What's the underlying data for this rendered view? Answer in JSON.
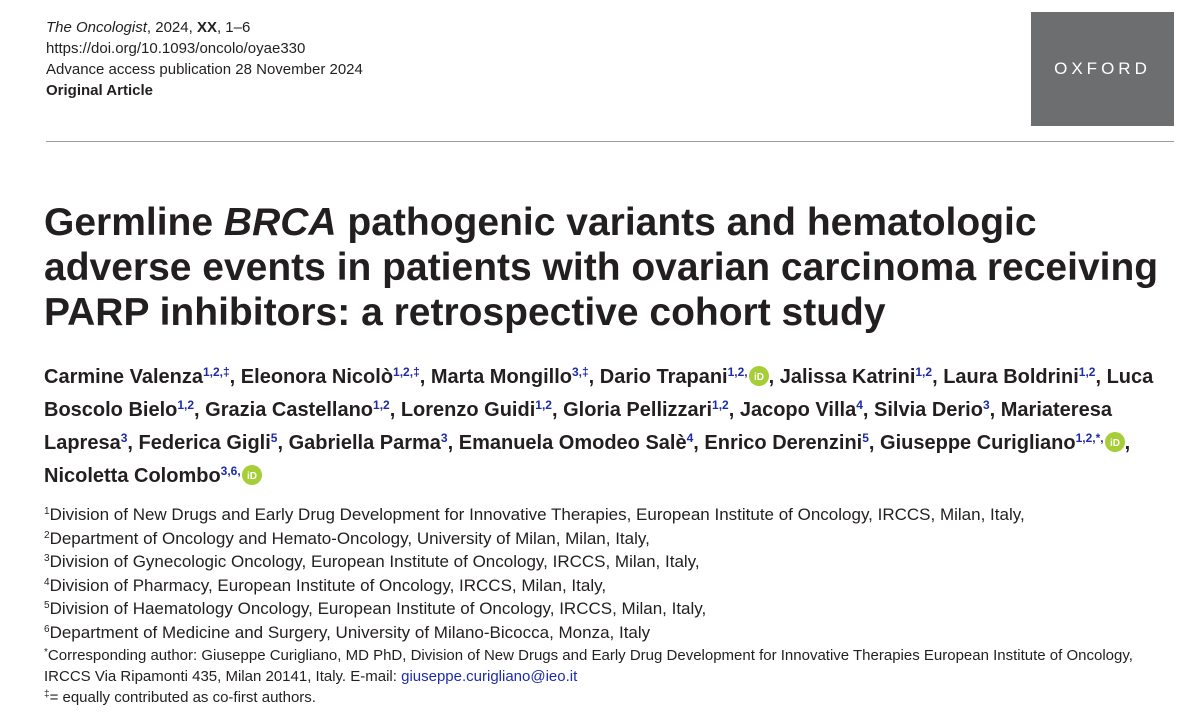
{
  "header": {
    "journal": "The Oncologist",
    "year": "2024, ",
    "volume": "XX",
    "pages": ", 1–6",
    "doi": "https://doi.org/10.1093/oncolo/oyae330",
    "publication": "Advance access publication 28 November 2024",
    "article_type": "Original Article"
  },
  "logo": {
    "text": "OXFORD",
    "color": "#6d6e70"
  },
  "title": {
    "part1": "Germline ",
    "italic": "BRCA",
    "part2": " pathogenic variants and hematologic adverse events in patients with ovarian carcinoma receiving PARP inhibitors: a retrospective cohort study"
  },
  "authors": [
    {
      "name": "Carmine Valenza",
      "sup": "1,2,‡",
      "orcid": false,
      "sep": ", "
    },
    {
      "name": "Eleonora Nicolò",
      "sup": "1,2,‡",
      "orcid": false,
      "sep": ", "
    },
    {
      "name": "Marta Mongillo",
      "sup": "3,‡",
      "orcid": false,
      "sep": ", "
    },
    {
      "name": "Dario Trapani",
      "sup": "1,2,",
      "orcid": true,
      "sep": ", "
    },
    {
      "name": "Jalissa Katrini",
      "sup": "1,2",
      "orcid": false,
      "sep": ", "
    },
    {
      "name": "Laura Boldrini",
      "sup": "1,2",
      "orcid": false,
      "sep": ", "
    },
    {
      "name": "Luca Boscolo Bielo",
      "sup": "1,2",
      "orcid": false,
      "sep": ", "
    },
    {
      "name": "Grazia Castellano",
      "sup": "1,2",
      "orcid": false,
      "sep": ", "
    },
    {
      "name": "Lorenzo Guidi",
      "sup": "1,2",
      "orcid": false,
      "sep": ", "
    },
    {
      "name": "Gloria Pellizzari",
      "sup": "1,2",
      "orcid": false,
      "sep": ", "
    },
    {
      "name": "Jacopo Villa",
      "sup": "4",
      "orcid": false,
      "sep": ", "
    },
    {
      "name": "Silvia Derio",
      "sup": "3",
      "orcid": false,
      "sep": ", "
    },
    {
      "name": "Mariateresa Lapresa",
      "sup": "3",
      "orcid": false,
      "sep": ", "
    },
    {
      "name": "Federica Gigli",
      "sup": "5",
      "orcid": false,
      "sep": ", "
    },
    {
      "name": "Gabriella Parma",
      "sup": "3",
      "orcid": false,
      "sep": ", "
    },
    {
      "name": "Emanuela Omodeo Salè",
      "sup": "4",
      "orcid": false,
      "sep": ", "
    },
    {
      "name": "Enrico Derenzini",
      "sup": "5",
      "orcid": false,
      "sep": ", "
    },
    {
      "name": "Giuseppe Curigliano",
      "sup": "1,2,*,",
      "orcid": true,
      "sep": ", "
    },
    {
      "name": "Nicoletta Colombo",
      "sup": "3,6,",
      "orcid": true,
      "sep": ""
    }
  ],
  "affiliations": [
    {
      "num": "1",
      "text": "Division of New Drugs and Early Drug Development for Innovative Therapies, European Institute of Oncology, IRCCS, Milan, Italy,"
    },
    {
      "num": "2",
      "text": "Department of Oncology and Hemato-Oncology, University of Milan, Milan, Italy,"
    },
    {
      "num": "3",
      "text": "Division of Gynecologic Oncology, European Institute of Oncology, IRCCS, Milan, Italy,"
    },
    {
      "num": "4",
      "text": "Division of Pharmacy, European Institute of Oncology, IRCCS, Milan, Italy,"
    },
    {
      "num": "5",
      "text": "Division of Haematology Oncology, European Institute of Oncology, IRCCS, Milan, Italy,"
    },
    {
      "num": "6",
      "text": "Department of Medicine and Surgery, University of Milano-Bicocca, Monza, Italy"
    }
  ],
  "corresponding": {
    "marker": "*",
    "text": "Corresponding author: Giuseppe Curigliano, MD PhD, Division of New Drugs and Early Drug Development for Innovative Therapies European Institute of Oncology, IRCCS Via Ripamonti 435, Milan 20141, Italy. E-mail: ",
    "email": "giuseppe.curigliano@ieo.it",
    "equal_marker": "‡",
    "equal_text": "= equally contributed as co-first authors."
  },
  "colors": {
    "link": "#1d2ba8",
    "orcid": "#a6ce39",
    "text": "#231f20"
  }
}
